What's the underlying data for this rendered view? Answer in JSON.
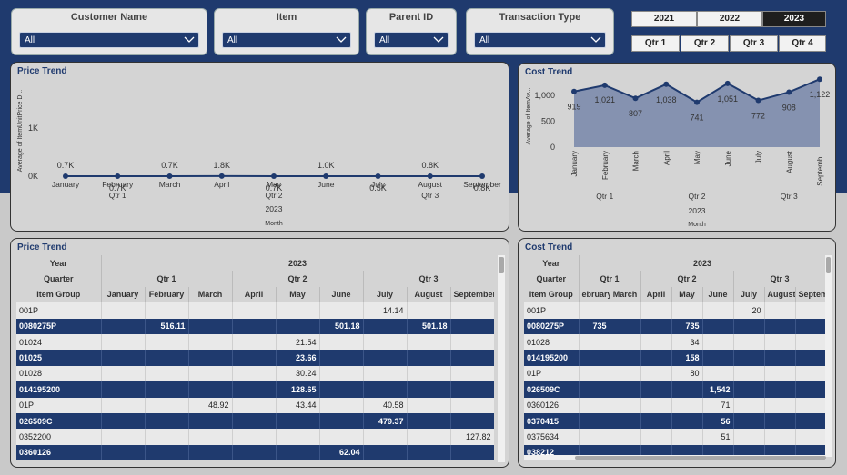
{
  "slicers": [
    {
      "label": "Customer Name",
      "value": "All"
    },
    {
      "label": "Item",
      "value": "All"
    },
    {
      "label": "Parent ID",
      "value": "All"
    },
    {
      "label": "Transaction Type",
      "value": "All"
    }
  ],
  "years": [
    {
      "label": "2021",
      "selected": false
    },
    {
      "label": "2022",
      "selected": false
    },
    {
      "label": "2023",
      "selected": true
    }
  ],
  "quarters": [
    "Qtr 1",
    "Qtr 2",
    "Qtr 3",
    "Qtr 4"
  ],
  "chart_data": [
    {
      "type": "area",
      "title": "Price Trend",
      "ylabel": "Average of ItemUnitPrice D...",
      "xlabel": "Month",
      "ylim": [
        0,
        2000
      ],
      "yticks": [
        "0K",
        "1K"
      ],
      "categories": [
        "January",
        "February",
        "March",
        "April",
        "May",
        "June",
        "July",
        "August",
        "September"
      ],
      "values": [
        0.7,
        0.65,
        0.7,
        1.8,
        0.7,
        1.0,
        0.5,
        0.8,
        0.78
      ],
      "data_labels": [
        "0.7K",
        "0.7K",
        "0.7K",
        "1.8K",
        "0.7K",
        "1.0K",
        "0.5K",
        "0.8K",
        "0.8K"
      ],
      "quarter_labels": [
        {
          "label": "Qtr 1",
          "at": 1
        },
        {
          "label": "Qtr 2",
          "at": 4
        },
        {
          "label": "Qtr 3",
          "at": 7
        }
      ],
      "year_label": "2023",
      "series_color": "#1f3a6e",
      "fill_color": "#8592b0"
    },
    {
      "type": "area",
      "title": "Cost Trend",
      "ylabel": "Average of ItemAv...",
      "xlabel": "Month",
      "ylim": [
        0,
        1200
      ],
      "yticks": [
        "0",
        "500",
        "1,000"
      ],
      "categories": [
        "January",
        "February",
        "March",
        "April",
        "May",
        "June",
        "July",
        "August",
        "Septemb..."
      ],
      "values": [
        919,
        1021,
        807,
        1038,
        741,
        1051,
        772,
        908,
        1122
      ],
      "data_labels": [
        "919",
        "1,021",
        "807",
        "1,038",
        "741",
        "1,051",
        "772",
        "908",
        "1,122"
      ],
      "quarter_labels": [
        {
          "label": "Qtr 1",
          "at": 1
        },
        {
          "label": "Qtr 2",
          "at": 4
        },
        {
          "label": "Qtr 3",
          "at": 7
        }
      ],
      "year_label": "2023",
      "series_color": "#1f3a6e",
      "fill_color": "#8592b0"
    }
  ],
  "price_table": {
    "title": "Price Trend",
    "row_labels": [
      "Year",
      "Quarter",
      "Item Group"
    ],
    "year": "2023",
    "quarters": [
      "Qtr 1",
      "Qtr 2",
      "Qtr 3"
    ],
    "months": [
      "January",
      "February",
      "March",
      "April",
      "May",
      "June",
      "July",
      "August",
      "September"
    ],
    "rows": [
      {
        "group": "001P",
        "cells": [
          "",
          "",
          "",
          "",
          "",
          "",
          "14.14",
          "",
          ""
        ]
      },
      {
        "group": "0080275P",
        "cells": [
          "",
          "516.11",
          "",
          "",
          "",
          "501.18",
          "",
          "501.18",
          ""
        ]
      },
      {
        "group": "01024",
        "cells": [
          "",
          "",
          "",
          "",
          "21.54",
          "",
          "",
          "",
          ""
        ]
      },
      {
        "group": "01025",
        "cells": [
          "",
          "",
          "",
          "",
          "23.66",
          "",
          "",
          "",
          ""
        ]
      },
      {
        "group": "01028",
        "cells": [
          "",
          "",
          "",
          "",
          "30.24",
          "",
          "",
          "",
          ""
        ]
      },
      {
        "group": "014195200",
        "cells": [
          "",
          "",
          "",
          "",
          "128.65",
          "",
          "",
          "",
          ""
        ]
      },
      {
        "group": "01P",
        "cells": [
          "",
          "",
          "48.92",
          "",
          "43.44",
          "",
          "40.58",
          "",
          ""
        ]
      },
      {
        "group": "026509C",
        "cells": [
          "",
          "",
          "",
          "",
          "",
          "",
          "479.37",
          "",
          ""
        ]
      },
      {
        "group": "0352200",
        "cells": [
          "",
          "",
          "",
          "",
          "",
          "",
          "",
          "",
          "127.82"
        ]
      },
      {
        "group": "0360126",
        "cells": [
          "",
          "",
          "",
          "",
          "",
          "62.04",
          "",
          "",
          ""
        ]
      }
    ]
  },
  "cost_table": {
    "title": "Cost Trend",
    "row_labels": [
      "Year",
      "Quarter",
      "Item Group"
    ],
    "year": "2023",
    "quarters": [
      "Qtr 1",
      "Qtr 2",
      "Qtr 3"
    ],
    "months": [
      "ebruary",
      "March",
      "April",
      "May",
      "June",
      "July",
      "August",
      "September"
    ],
    "rows": [
      {
        "group": "001P",
        "cells": [
          "",
          "",
          "",
          "",
          "",
          "20",
          "",
          ""
        ]
      },
      {
        "group": "0080275P",
        "cells": [
          "735",
          "",
          "",
          "735",
          "",
          "",
          "",
          ""
        ]
      },
      {
        "group": "01028",
        "cells": [
          "",
          "",
          "",
          "34",
          "",
          "",
          "",
          ""
        ]
      },
      {
        "group": "014195200",
        "cells": [
          "",
          "",
          "",
          "158",
          "",
          "",
          "",
          ""
        ]
      },
      {
        "group": "01P",
        "cells": [
          "",
          "",
          "",
          "80",
          "",
          "",
          "",
          ""
        ]
      },
      {
        "group": "026509C",
        "cells": [
          "",
          "",
          "",
          "",
          "1,542",
          "",
          "",
          ""
        ]
      },
      {
        "group": "0360126",
        "cells": [
          "",
          "",
          "",
          "",
          "71",
          "",
          "",
          ""
        ]
      },
      {
        "group": "0370415",
        "cells": [
          "",
          "",
          "",
          "",
          "56",
          "",
          "",
          ""
        ]
      },
      {
        "group": "0375634",
        "cells": [
          "",
          "",
          "",
          "",
          "51",
          "",
          "",
          ""
        ]
      },
      {
        "group": "038212",
        "cells": [
          "",
          "",
          "",
          "",
          "",
          "",
          "",
          ""
        ]
      }
    ]
  }
}
